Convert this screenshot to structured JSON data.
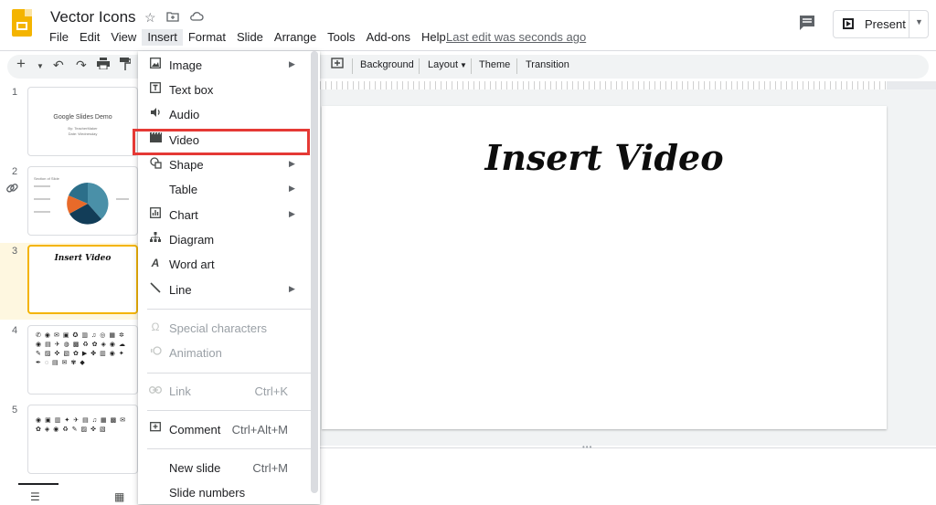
{
  "header": {
    "doc_title": "Vector Icons",
    "star_icon": "star-icon",
    "move_icon": "folder-move-icon",
    "cloud_icon": "cloud-status-icon",
    "last_edit": "Last edit was seconds ago",
    "present_label": "Present"
  },
  "menubar": {
    "items": [
      "File",
      "Edit",
      "View",
      "Insert",
      "Format",
      "Slide",
      "Arrange",
      "Tools",
      "Add-ons",
      "Help"
    ],
    "active": "Insert"
  },
  "toolbar": {
    "background": "Background",
    "layout": "Layout",
    "theme": "Theme",
    "transition": "Transition"
  },
  "filmstrip": {
    "slides": [
      {
        "number": "1",
        "title": "Google Slides Demo",
        "subtitle_1": "By: TeacherMaker",
        "subtitle_2": "Date: Wednesday"
      },
      {
        "number": "2",
        "title": "Section of Slide"
      },
      {
        "number": "3",
        "title": "Insert Video"
      },
      {
        "number": "4"
      },
      {
        "number": "5"
      }
    ],
    "selected": 3
  },
  "slide": {
    "title": "Insert Video"
  },
  "insert_menu": {
    "items": [
      {
        "label": "Image",
        "icon": "image-icon",
        "submenu": true
      },
      {
        "label": "Text box",
        "icon": "text-box-icon"
      },
      {
        "label": "Audio",
        "icon": "audio-icon"
      },
      {
        "label": "Video",
        "icon": "video-icon",
        "highlighted": true
      },
      {
        "label": "Shape",
        "icon": "shape-icon",
        "submenu": true
      },
      {
        "label": "Table",
        "submenu": true
      },
      {
        "label": "Chart",
        "icon": "chart-icon",
        "submenu": true
      },
      {
        "label": "Diagram",
        "icon": "diagram-icon"
      },
      {
        "label": "Word art",
        "icon": "word-art-icon"
      },
      {
        "label": "Line",
        "icon": "line-icon",
        "submenu": true
      },
      {
        "label": "Special characters",
        "icon": "omega-icon",
        "disabled": true
      },
      {
        "label": "Animation",
        "icon": "animation-icon",
        "disabled": true
      },
      {
        "label": "Link",
        "icon": "link-icon",
        "shortcut": "Ctrl+K",
        "disabled": true
      },
      {
        "label": "Comment",
        "icon": "comment-add-icon",
        "shortcut": "Ctrl+Alt+M"
      },
      {
        "label": "New slide",
        "shortcut": "Ctrl+M"
      },
      {
        "label": "Slide numbers"
      }
    ]
  },
  "colors": {
    "highlight_border": "#e53935",
    "slides_logo": "#f4b400",
    "selected_slide_bg": "#fef7e0",
    "active_menu_bg": "#e8eaed"
  }
}
